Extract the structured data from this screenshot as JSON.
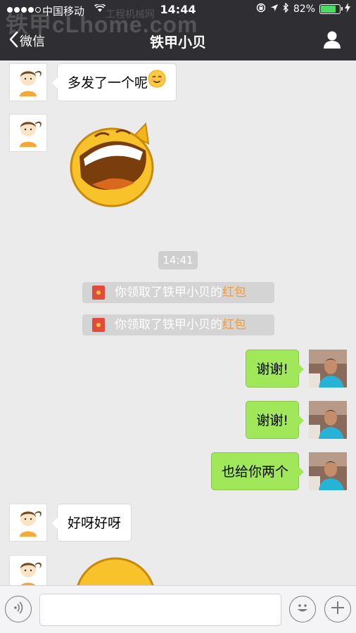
{
  "status_bar": {
    "carrier": "中国移动",
    "time": "14:44",
    "battery": "82%",
    "battery_level": 0.82
  },
  "watermark": {
    "logo": "铁甲cLhome.com",
    "text": "工程机械网"
  },
  "nav": {
    "back_label": "微信",
    "title": "铁甲小贝"
  },
  "messages": {
    "m1": "多发了一个呢",
    "time_pill": "14:41",
    "sys1": {
      "prefix": "你领取了铁甲小贝的",
      "highlight": "红包"
    },
    "sys2": {
      "prefix": "你领取了铁甲小贝的",
      "highlight": "红包"
    },
    "r1": "谢谢!",
    "r2": "谢谢!",
    "r3": "也给你两个",
    "m2": "好呀好呀"
  },
  "colors": {
    "topbar": "#2f2f33",
    "chat_bg": "#ebebeb",
    "sent_bubble": "#a0e75a",
    "highlight": "#f39c36"
  },
  "icons": [
    "chevron-left-icon",
    "profile-icon",
    "voice-icon",
    "emoji-icon",
    "plus-icon",
    "red-packet-icon",
    "smile-emoji-icon"
  ]
}
